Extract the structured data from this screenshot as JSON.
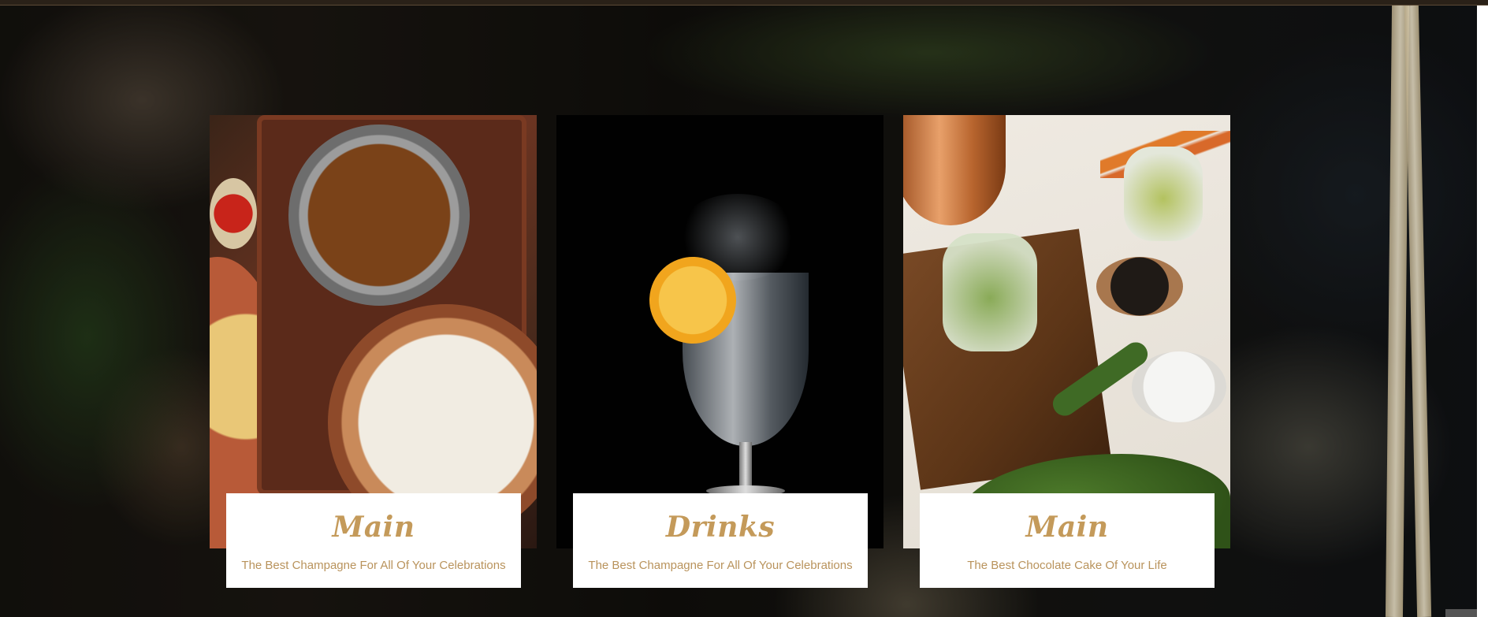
{
  "cards": [
    {
      "title": "Main",
      "subtitle": "The Best Champagne For All Of Your Celebrations",
      "image": "curry-and-rice-photo"
    },
    {
      "title": "Drinks",
      "subtitle": "The Best Champagne For All Of Your Celebrations",
      "image": "sparkling-drink-photo"
    },
    {
      "title": "Main",
      "subtitle": "The Best Chocolate Cake Of Your Life",
      "image": "pickling-ingredients-photo"
    }
  ],
  "colors": {
    "accent": "#c49a5a",
    "subtitle": "#b9935c",
    "caption_bg": "#ffffff"
  }
}
